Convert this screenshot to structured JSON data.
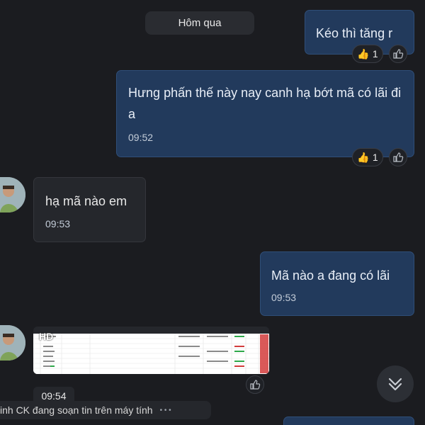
{
  "date_separator": "Hôm qua",
  "messages": [
    {
      "text": "Kéo thì tăng r",
      "reaction_emoji": "👍",
      "reaction_count": "1"
    },
    {
      "text": "Hưng phấn thế này nay canh hạ bớt mã có lãi đi a",
      "time": "09:52",
      "reaction_emoji": "👍",
      "reaction_count": "1"
    },
    {
      "text": "hạ mã nào em",
      "time": "09:53"
    },
    {
      "text": "Mã nào a đang có lãi",
      "time": "09:53"
    },
    {
      "image_badge": "HD",
      "time": "09:54"
    }
  ],
  "typing_indicator": "inh CK đang soạn tin trên máy tính",
  "typing_dots": "• • •",
  "icons": {
    "like": "thumbs-up-icon",
    "scroll": "chevrons-down-icon"
  }
}
